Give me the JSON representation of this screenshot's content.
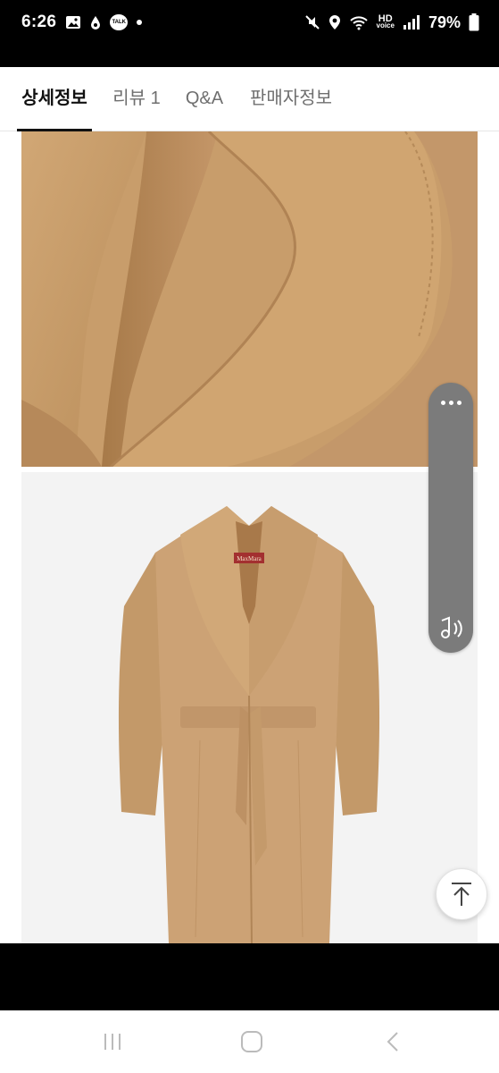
{
  "status_bar": {
    "time": "6:26",
    "battery_percent": "79%",
    "hd_top": "HD",
    "hd_bottom": "voice",
    "talk_label": "TALK"
  },
  "tabs": [
    {
      "label": "상세정보",
      "active": true
    },
    {
      "label": "리뷰 1",
      "active": false
    },
    {
      "label": "Q&A",
      "active": false
    },
    {
      "label": "판매자정보",
      "active": false
    }
  ],
  "product": {
    "label_brand": "MaxMara",
    "coat_color": "#c79d6a",
    "photo_bg": "#f2f2f2"
  },
  "icons": {
    "side_more": "more-dots-icon",
    "side_audio": "audio-icon",
    "scroll_top": "arrow-up-icon"
  },
  "nav": [
    "recent-apps-icon",
    "home-icon",
    "back-icon"
  ]
}
